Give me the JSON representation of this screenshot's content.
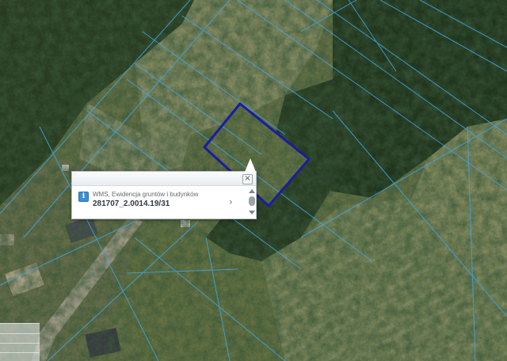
{
  "map": {
    "basemap": "orthophoto",
    "parcel_line_color": "#3fa6e6",
    "selected_parcel_color": "#1c1ca0"
  },
  "popup": {
    "layer_name": "WMS, Ewidencja gruntów i budynków",
    "parcel_id": "281707_2.0014.19/31",
    "info_icon": "i",
    "close_icon": "×",
    "next_icon": "›"
  }
}
